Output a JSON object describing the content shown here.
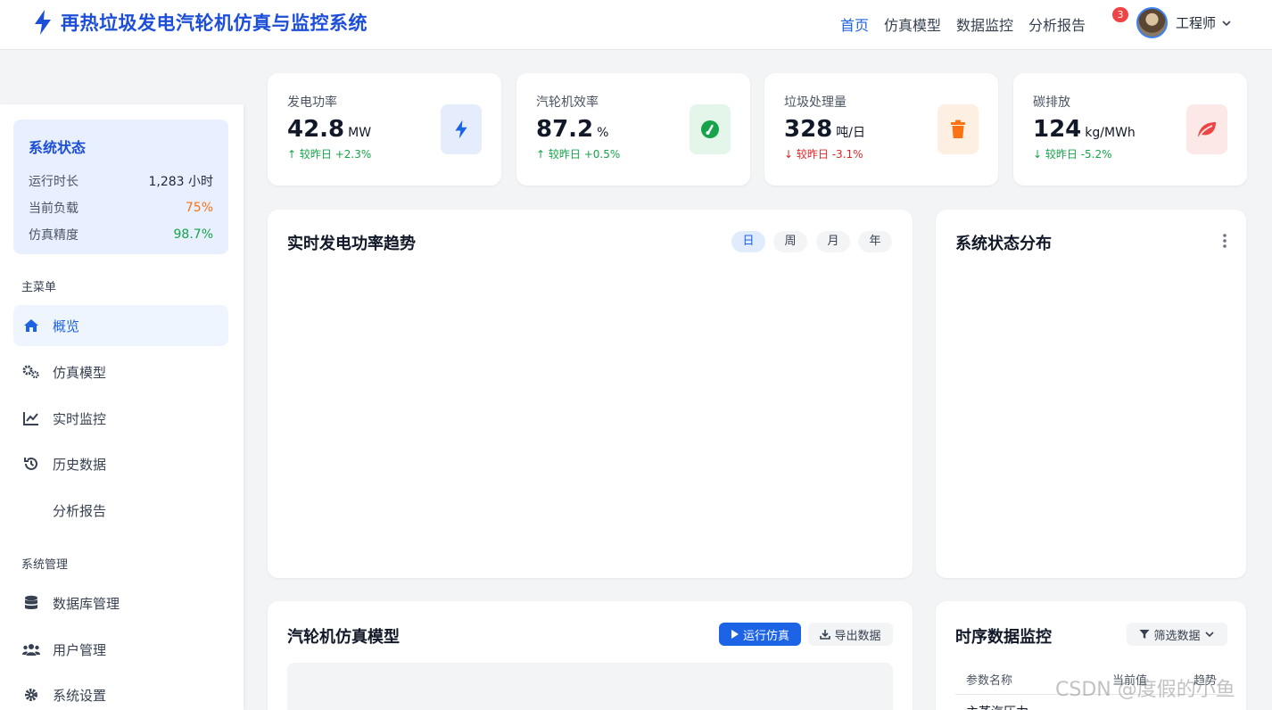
{
  "app": {
    "title": "再热垃圾发电汽轮机仿真与监控系统",
    "nav": [
      "首页",
      "仿真模型",
      "数据监控",
      "分析报告"
    ],
    "notification_count": "3",
    "user_name": "工程师"
  },
  "sidebar": {
    "status": {
      "title": "系统状态",
      "rows": [
        {
          "label": "运行时长",
          "value": "1,283 小时"
        },
        {
          "label": "当前负载",
          "value": "75%"
        },
        {
          "label": "仿真精度",
          "value": "98.7%"
        }
      ]
    },
    "main_menu_title": "主菜单",
    "main_menu": [
      {
        "label": "概览",
        "icon": "home-icon"
      },
      {
        "label": "仿真模型",
        "icon": "cogs-icon"
      },
      {
        "label": "实时监控",
        "icon": "line-chart-icon"
      },
      {
        "label": "历史数据",
        "icon": "history-icon"
      },
      {
        "label": "分析报告",
        "icon": ""
      }
    ],
    "system_menu_title": "系统管理",
    "system_menu": [
      {
        "label": "数据库管理",
        "icon": "database-icon"
      },
      {
        "label": "用户管理",
        "icon": "users-icon"
      },
      {
        "label": "系统设置",
        "icon": "gear-icon"
      }
    ]
  },
  "stats": [
    {
      "label": "发电功率",
      "value": "42.8",
      "unit": "MW",
      "change": "较昨日 +2.3%",
      "direction": "up",
      "icon": "bolt-icon",
      "color": "#1d63e6",
      "bg": "#e5edfd"
    },
    {
      "label": "汽轮机效率",
      "value": "87.2",
      "unit": "%",
      "change": "较昨日 +0.5%",
      "direction": "up",
      "icon": "gauge-icon",
      "color": "#16a34a",
      "bg": "#e4f6ea"
    },
    {
      "label": "垃圾处理量",
      "value": "328",
      "unit": "吨/日",
      "change": "较昨日 -3.1%",
      "direction": "down",
      "icon": "trash-icon",
      "color": "#f97316",
      "bg": "#fdf0e3"
    },
    {
      "label": "碳排放",
      "value": "124",
      "unit": "kg/MWh",
      "change": "较昨日 -5.2%",
      "direction": "down",
      "icon": "leaf-icon",
      "color": "#ef4444",
      "bg": "#fde8e8",
      "change_color": "#16a34a"
    }
  ],
  "trend_panel": {
    "title": "实时发电功率趋势",
    "ranges": [
      "日",
      "周",
      "月",
      "年"
    ]
  },
  "status_dist_panel": {
    "title": "系统状态分布"
  },
  "sim_panel": {
    "title": "汽轮机仿真模型",
    "run_label": "运行仿真",
    "export_label": "导出数据"
  },
  "ts_panel": {
    "title": "时序数据监控",
    "filter_label": "筛选数据",
    "columns": [
      "参数名称",
      "当前值",
      "趋势"
    ],
    "first_row_label": "主蒸汽压力"
  },
  "watermark": "CSDN @度假的小鱼"
}
